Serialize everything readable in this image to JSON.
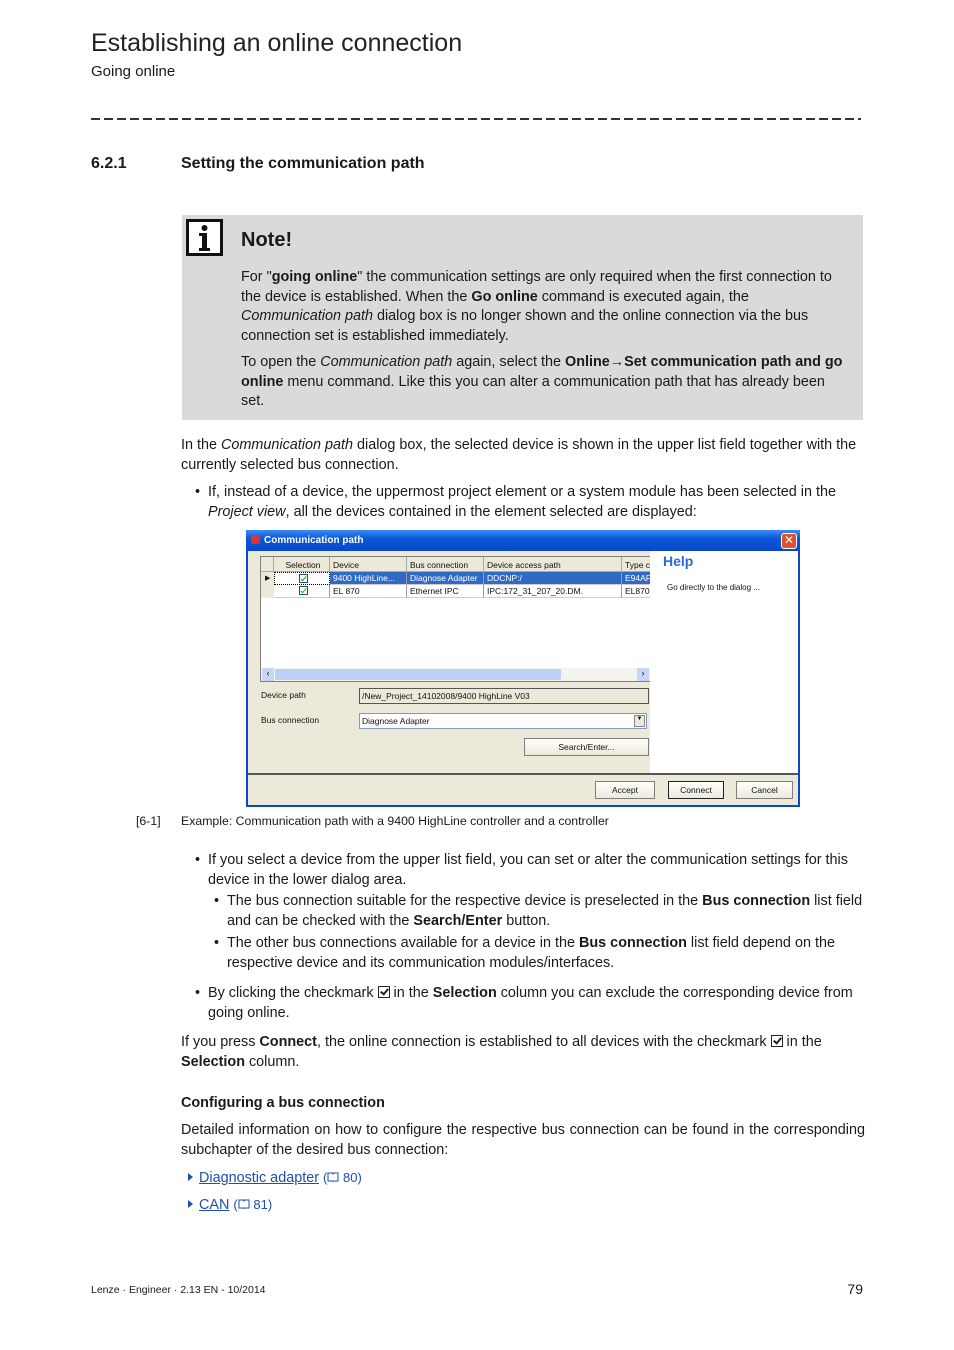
{
  "header": {
    "title": "Establishing an online connection",
    "subtitle": "Going online"
  },
  "section": {
    "number": "6.2.1",
    "title": "Setting the communication path"
  },
  "note": {
    "icon": "info-icon",
    "title": "Note!",
    "p1": [
      {
        "t": "For \""
      },
      {
        "t": "going online",
        "s": "b"
      },
      {
        "t": "\" the communication settings are only required when the first connection to the device is established. When the "
      },
      {
        "t": "Go online",
        "s": "b"
      },
      {
        "t": " command is executed again, the "
      },
      {
        "t": "Communication path",
        "s": "i"
      },
      {
        "t": " dialog box is no longer shown and the online connection via the bus connection set is established immediately."
      }
    ],
    "p2": [
      {
        "t": "To open the "
      },
      {
        "t": "Communication path",
        "s": "i"
      },
      {
        "t": " again, select the "
      },
      {
        "t": "Online→Set communication path and go online",
        "s": "b"
      },
      {
        "t": " menu command. Like this you can alter a communication path that has already been set."
      }
    ]
  },
  "intro": [
    {
      "t": "In the "
    },
    {
      "t": "Communication path",
      "s": "i"
    },
    {
      "t": " dialog box, the selected device is shown in the upper list field together with the currently selected bus connection."
    }
  ],
  "bullet1": [
    {
      "t": "If, instead of a device, the uppermost project element or a system module has been selected in the "
    },
    {
      "t": "Project view",
      "s": "i"
    },
    {
      "t": ", all the devices contained in the element selected are displayed:"
    }
  ],
  "dialog": {
    "title": "Communication path",
    "columns": [
      "Selection",
      "Device",
      "Bus connection",
      "Device access path",
      "Type c"
    ],
    "rows": [
      {
        "device": "9400 HighLine...",
        "bus": "Diagnose Adapter",
        "path": "DDCNP:/",
        "type": "E94AF",
        "checked": true
      },
      {
        "device": "EL 870",
        "bus": "Ethernet IPC",
        "path": "IPC:172_31_207_20.DM.",
        "type": "EL870",
        "checked": true
      }
    ],
    "device_path_label": "Device path",
    "device_path_value": "/New_Project_14102008/9400 HighLine V03",
    "bus_connection_label": "Bus connection",
    "bus_connection_value": "Diagnose Adapter",
    "search_button": "Search/Enter...",
    "help_title": "Help",
    "help_text": "Go directly to the dialog ...",
    "accept": "Accept",
    "connect": "Connect",
    "cancel": "Cancel"
  },
  "figure": {
    "number": "[6-1]",
    "caption": "Example: Communication path with a 9400 HighLine controller and a controller"
  },
  "bullet2": [
    {
      "t": "If you select a device from the upper list field, you can set or alter the communication settings for this device in the lower dialog area."
    }
  ],
  "sub1": [
    {
      "t": "The bus connection suitable for the respective device is preselected in the "
    },
    {
      "t": "Bus connection",
      "s": "b"
    },
    {
      "t": " list field and can be checked with the "
    },
    {
      "t": "Search/Enter",
      "s": "b"
    },
    {
      "t": " button."
    }
  ],
  "sub2": [
    {
      "t": "The other bus connections available for a device in the "
    },
    {
      "t": "Bus connection",
      "s": "b"
    },
    {
      "t": " list field depend on the respective device and its communication modules/interfaces."
    }
  ],
  "bullet3a": [
    {
      "t": "By clicking the checkmark "
    }
  ],
  "bullet3b": [
    {
      "t": " in the "
    },
    {
      "t": "Selection",
      "s": "b"
    },
    {
      "t": " column you can exclude the corresponding device from going online."
    }
  ],
  "connect_a": [
    {
      "t": "If you press "
    },
    {
      "t": "Connect",
      "s": "b"
    },
    {
      "t": ", the online connection is established to all devices with the checkmark "
    }
  ],
  "connect_b": [
    {
      "t": " in the "
    },
    {
      "t": "Selection",
      "s": "b"
    },
    {
      "t": " column."
    }
  ],
  "config": {
    "heading": "Configuring a bus connection",
    "text": "Detailed information on how to configure the respective bus connection can be found in the corresponding subchapter of the desired bus connection:",
    "links": [
      {
        "label": "Diagnostic adapter",
        "page": "80"
      },
      {
        "label": "CAN",
        "page": "81"
      }
    ]
  },
  "footer": {
    "left": "Lenze · Engineer · 2.13 EN - 10/2014",
    "page": "79"
  }
}
